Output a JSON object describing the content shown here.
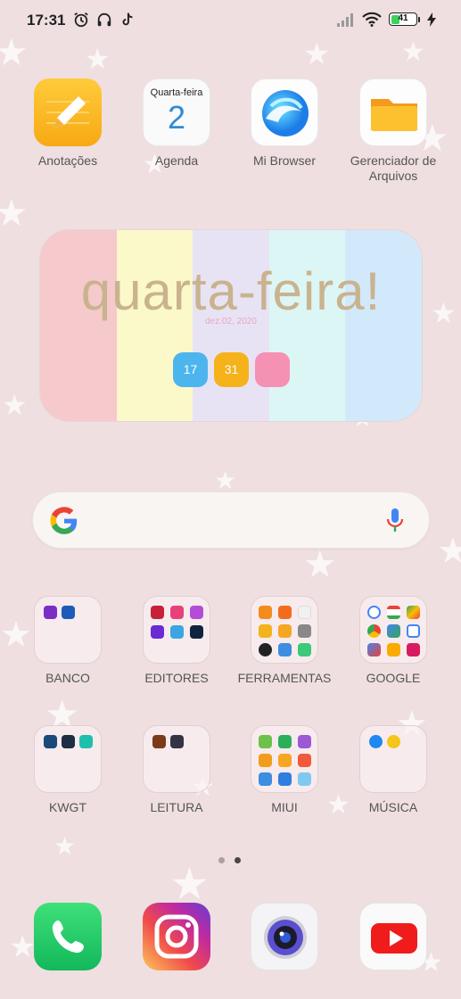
{
  "status_bar": {
    "time": "17:31",
    "battery": "41",
    "battery_level_pct": 41,
    "left_icons": [
      "alarm-icon",
      "headphones-icon",
      "tiktok-icon"
    ],
    "right_icons": [
      "signal-icon",
      "wifi-icon",
      "battery-icon",
      "charging-icon"
    ]
  },
  "apps_top": [
    {
      "label": "Anotações",
      "icon": "notes-icon"
    },
    {
      "label": "Agenda",
      "icon": "calendar-icon",
      "day_name": "Quarta-feira",
      "day_number": "2"
    },
    {
      "label": "Mi Browser",
      "icon": "browser-icon"
    },
    {
      "label": "Gerenciador de Arquivos",
      "icon": "folder-icon"
    }
  ],
  "widget": {
    "title": "quarta-feira!",
    "date": "dez.02, 2020",
    "pills": [
      "17",
      "31",
      ""
    ],
    "stripe_colors": [
      "#f6c9cc",
      "#fbf8c9",
      "#e8e3f4",
      "#dcf6f6",
      "#d2e9fb"
    ]
  },
  "search": {
    "logo": "google-logo-icon",
    "mic": "mic-icon"
  },
  "folders": [
    {
      "label": "BANCO"
    },
    {
      "label": "EDITORES"
    },
    {
      "label": "FERRAMENTAS"
    },
    {
      "label": "GOOGLE"
    },
    {
      "label": "KWGT"
    },
    {
      "label": "LEITURA"
    },
    {
      "label": "MIUI"
    },
    {
      "label": "MÚSICA"
    }
  ],
  "page_indicator": {
    "pages": 2,
    "active": 2
  },
  "dock": [
    {
      "icon": "phone-icon"
    },
    {
      "icon": "instagram-icon"
    },
    {
      "icon": "camera-icon"
    },
    {
      "icon": "youtube-icon"
    }
  ],
  "colors": {
    "background": "#efdfe0",
    "pill_blue": "#4db5ee",
    "pill_orange": "#f5b21b",
    "pill_pink": "#f591b3",
    "title_gold": "#c9b38f"
  }
}
